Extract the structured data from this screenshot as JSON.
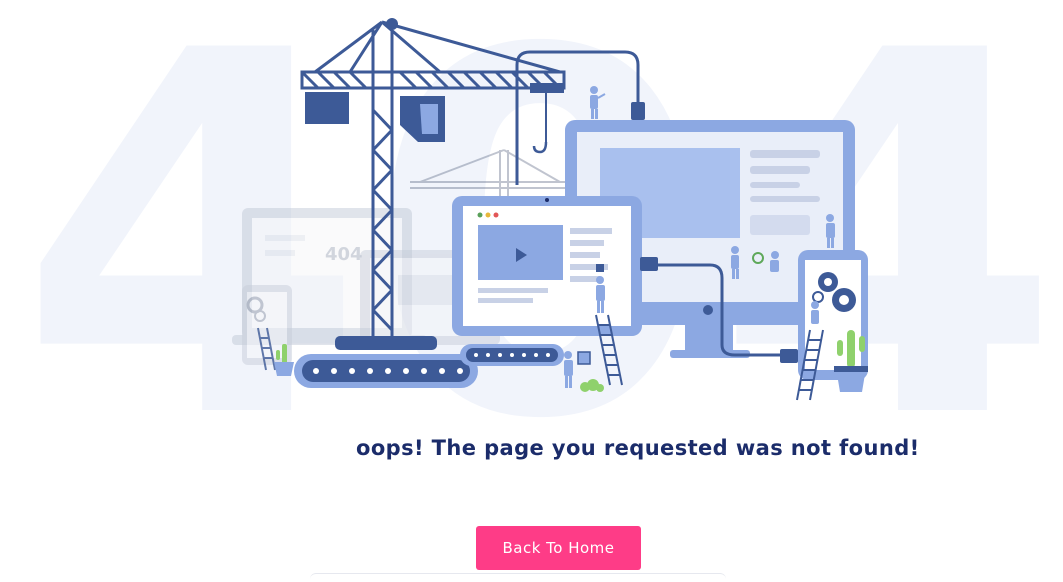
{
  "background_text": "404",
  "message": "oops! The page you requested was not found!",
  "home_button": {
    "label": "Back To Home"
  },
  "illustration": {
    "screen_label": "404",
    "colors": {
      "primary": "#3d5a97",
      "light": "#8ca8e2",
      "pale": "#e9eef9",
      "accent": "#fe3c87",
      "title": "#1b2c6a",
      "plant": "#8fd16c"
    }
  }
}
